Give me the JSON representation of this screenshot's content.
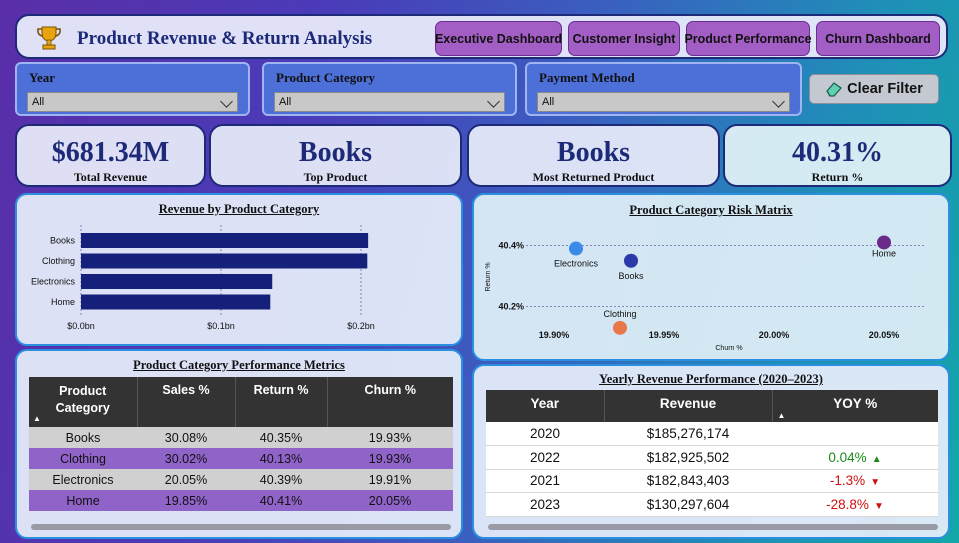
{
  "header": {
    "title": "Product Revenue & Return Analysis",
    "nav": [
      "Executive Dashboard",
      "Customer Insight",
      "Product Performance",
      "Churn Dashboard"
    ]
  },
  "filters": [
    {
      "label": "Year",
      "value": "All"
    },
    {
      "label": "Product Category",
      "value": "All"
    },
    {
      "label": "Payment Method",
      "value": "All"
    }
  ],
  "clear_filter_label": "Clear Filter",
  "kpis": [
    {
      "value": "$681.34M",
      "label": "Total Revenue"
    },
    {
      "value": "Books",
      "label": "Top Product"
    },
    {
      "value": "Books",
      "label": "Most Returned Product"
    },
    {
      "value": "40.31%",
      "label": "Return %"
    }
  ],
  "colors": {
    "navy": "#1c2a78",
    "bar": "#15207a",
    "purple_row": "#9063c9",
    "grey_row": "#d0d0d0",
    "table_header": "#333333",
    "up": "#1a8a1a",
    "down": "#d01010"
  },
  "chart_data": [
    {
      "type": "bar",
      "orientation": "horizontal",
      "title": "Revenue by Product Category",
      "categories": [
        "Books",
        "Clothing",
        "Electronics",
        "Home"
      ],
      "values": [
        0.2051,
        0.2045,
        0.1366,
        0.1352
      ],
      "unit": "bn",
      "xlim": [
        0,
        0.22
      ],
      "xticks": [
        0,
        0.1,
        0.2
      ],
      "xtick_labels": [
        "$0.0bn",
        "$0.1bn",
        "$0.2bn"
      ],
      "grid": true
    },
    {
      "type": "scatter",
      "title": "Product Category Risk Matrix",
      "xlabel": "Churn %",
      "ylabel": "Return %",
      "xticks": [
        19.9,
        19.95,
        20.0,
        20.05
      ],
      "xtick_labels": [
        "19.90%",
        "19.95%",
        "20.00%",
        "20.05%"
      ],
      "yticks": [
        40.2,
        40.4
      ],
      "ytick_labels": [
        "40.2%",
        "40.4%"
      ],
      "xlim": [
        19.89,
        20.06
      ],
      "ylim": [
        40.1,
        40.5
      ],
      "points": [
        {
          "label": "Electronics",
          "x": 19.91,
          "y": 40.39,
          "color": "#3a8be8"
        },
        {
          "label": "Books",
          "x": 19.935,
          "y": 40.35,
          "color": "#2a3aa8"
        },
        {
          "label": "Clothing",
          "x": 19.93,
          "y": 40.13,
          "color": "#e8784a"
        },
        {
          "label": "Home",
          "x": 20.05,
          "y": 40.41,
          "color": "#6a2a8a"
        }
      ]
    }
  ],
  "perf_table": {
    "title": "Product Category Performance Metrics",
    "headers": [
      "Product Category",
      "Sales %",
      "Return %",
      "Churn %"
    ],
    "rows": [
      [
        "Books",
        "30.08%",
        "40.35%",
        "19.93%"
      ],
      [
        "Clothing",
        "30.02%",
        "40.13%",
        "19.93%"
      ],
      [
        "Electronics",
        "20.05%",
        "40.39%",
        "19.91%"
      ],
      [
        "Home",
        "19.85%",
        "40.41%",
        "20.05%"
      ]
    ]
  },
  "yearly_table": {
    "title": "Yearly Revenue Performance (2020–2023)",
    "headers": [
      "Year",
      "Revenue",
      "YOY %"
    ],
    "rows": [
      {
        "year": "2020",
        "revenue": "$185,276,174",
        "yoy": "",
        "dir": ""
      },
      {
        "year": "2022",
        "revenue": "$182,925,502",
        "yoy": "0.04%",
        "dir": "up"
      },
      {
        "year": "2021",
        "revenue": "$182,843,403",
        "yoy": "-1.3%",
        "dir": "down"
      },
      {
        "year": "2023",
        "revenue": "$130,297,604",
        "yoy": "-28.8%",
        "dir": "down"
      }
    ]
  }
}
